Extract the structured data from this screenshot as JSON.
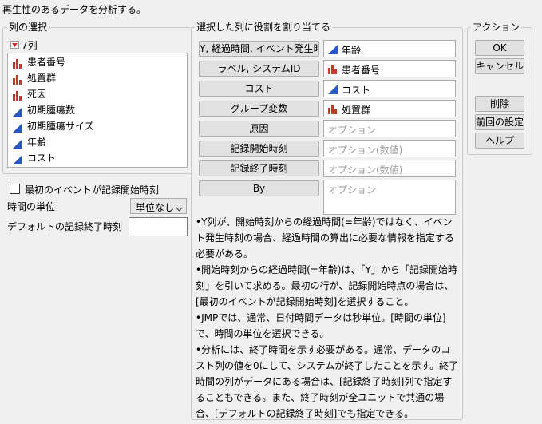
{
  "window": {
    "title": "再生性のあるデータを分析する。"
  },
  "column_select": {
    "title": "列の選択",
    "count_label": "7列",
    "columns": [
      {
        "label": "患者番号",
        "type": "nominal"
      },
      {
        "label": "処置群",
        "type": "nominal"
      },
      {
        "label": "死因",
        "type": "nominal"
      },
      {
        "label": "初期腫瘍数",
        "type": "continuous"
      },
      {
        "label": "初期腫瘍サイズ",
        "type": "continuous"
      },
      {
        "label": "年齢",
        "type": "continuous"
      },
      {
        "label": "コスト",
        "type": "continuous"
      }
    ]
  },
  "options": {
    "checkbox_label": "最初のイベントが記録開始時刻",
    "time_unit_label": "時間の単位",
    "time_unit_value": "単位なし",
    "default_end_label": "デフォルトの記録終了時刻",
    "default_end_value": ""
  },
  "roles": {
    "title": "選択した列に役割を割り当てる",
    "items": [
      {
        "button": "Y, 経過時間, イベント発生時刻",
        "value": "年齢",
        "placeholder": "",
        "icon": "continuous"
      },
      {
        "button": "ラベル, システムID",
        "value": "患者番号",
        "placeholder": "",
        "icon": "nominal"
      },
      {
        "button": "コスト",
        "value": "コスト",
        "placeholder": "",
        "icon": "continuous"
      },
      {
        "button": "グループ変数",
        "value": "処置群",
        "placeholder": "",
        "icon": "nominal"
      },
      {
        "button": "原因",
        "value": "",
        "placeholder": "オプション",
        "icon": ""
      },
      {
        "button": "記録開始時刻",
        "value": "",
        "placeholder": "オプション(数値)",
        "icon": ""
      },
      {
        "button": "記録終了時刻",
        "value": "",
        "placeholder": "オプション(数値)",
        "icon": ""
      },
      {
        "button": "By",
        "value": "",
        "placeholder": "オプション",
        "icon": ""
      }
    ]
  },
  "notes": [
    "•Y列が、開始時刻からの経過時間(=年齢)ではなく、イベント発生時刻の場合、経過時間の算出に必要な情報を指定する必要がある。",
    "•開始時刻からの経過時間(=年齢)は、「Y」から「記録開始時刻」を引いて求める。最初の行が、記録開始時点の場合は、[最初のイベントが記録開始時刻]を選択すること。",
    "•JMPでは、通常、日付時間データは秒単位。[時間の単位]で、時間の単位を選択できる。",
    "•分析には、終了時間を示す必要がある。通常、データのコスト列の値を0にして、システムが終了したことを示す。終了時間の列がデータにある場合は、[記録終了時刻]列で指定することもできる。また、終了時刻が全ユニットで共通の場合、[デフォルトの記録終了時刻]でも指定できる。"
  ],
  "actions": {
    "title": "アクション",
    "ok": "OK",
    "cancel": "キャンセル",
    "remove": "削除",
    "recall": "前回の設定",
    "help": "ヘルプ"
  },
  "colors": {
    "nominal_icon": "#c0392b",
    "continuous_icon": "#2a56c6",
    "button_bg": "#e1e1e1",
    "placeholder_text": "#9a9a9a"
  }
}
